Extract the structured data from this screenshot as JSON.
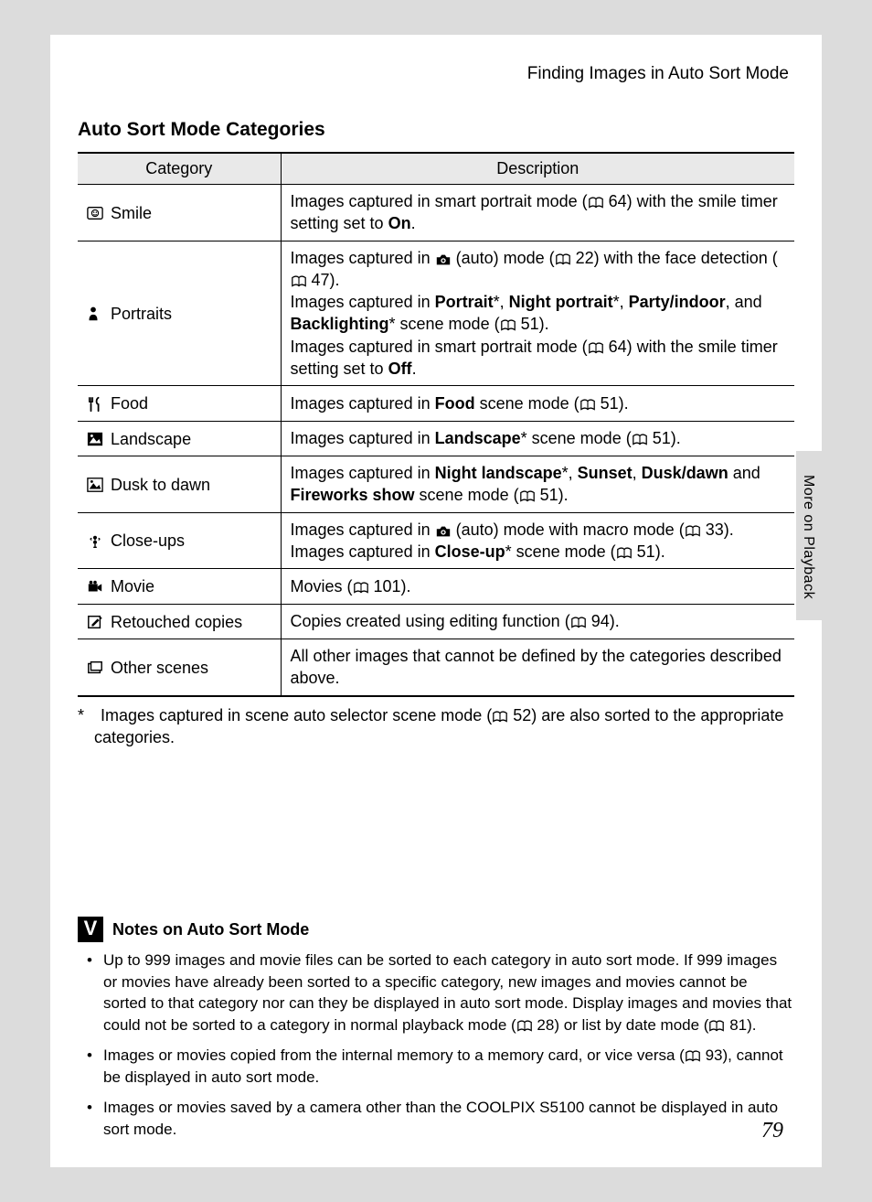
{
  "header": {
    "running": "Finding Images in Auto Sort Mode"
  },
  "section": {
    "title": "Auto Sort Mode Categories"
  },
  "table": {
    "head": {
      "c1": "Category",
      "c2": "Description"
    },
    "rows": [
      {
        "icon": "smile",
        "label": "Smile",
        "desc": "Images captured in smart portrait mode (📖 64) with the smile timer setting set to <b>On</b>."
      },
      {
        "icon": "portrait",
        "label": "Portraits",
        "desc": "Images captured in 📷 (auto) mode (📖 22) with the face detection (📖 47).<br>Images captured in <b>Portrait</b>*, <b>Night portrait</b>*, <b>Party/indoor</b>, and <b>Backlighting</b>* scene mode (📖 51).<br>Images captured in smart portrait mode (📖 64) with the smile timer setting set to <b>Off</b>."
      },
      {
        "icon": "food",
        "label": "Food",
        "desc": "Images captured in <b>Food</b> scene mode (📖 51)."
      },
      {
        "icon": "landscape",
        "label": "Landscape",
        "desc": "Images captured in <b>Landscape</b>* scene mode (📖 51)."
      },
      {
        "icon": "dusk",
        "label": "Dusk to dawn",
        "desc": "Images captured in <b>Night landscape</b>*, <b>Sunset</b>, <b>Dusk/dawn</b> and <b>Fireworks show</b> scene mode (📖 51)."
      },
      {
        "icon": "closeup",
        "label": "Close-ups",
        "desc": "Images captured in 📷 (auto) mode with macro mode (📖 33).<br>Images captured in <b>Close-up</b>* scene mode (📖 51)."
      },
      {
        "icon": "movie",
        "label": "Movie",
        "desc": "Movies (📖 101)."
      },
      {
        "icon": "retouch",
        "label": "Retouched copies",
        "desc": "Copies created using editing function (📖 94)."
      },
      {
        "icon": "other",
        "label": "Other scenes",
        "desc": "All other images that cannot be defined by the categories described above."
      }
    ]
  },
  "footnote": "* Images captured in scene auto selector scene mode (📖 52) are also sorted to the appropriate categories.",
  "sidetab": "More on Playback",
  "notes": {
    "title": "Notes on Auto Sort Mode",
    "items": [
      "Up to 999 images and movie files can be sorted to each category in auto sort mode. If 999 images or movies have already been sorted to a specific category, new images and movies cannot be sorted to that category nor can they be displayed in auto sort mode. Display images and movies that could not be sorted to a category in normal playback mode (📖 28) or list by date mode (📖 81).",
      "Images or movies copied from the internal memory to a memory card, or vice versa (📖 93), cannot be displayed in auto sort mode.",
      "Images or movies saved by a camera other than the COOLPIX S5100 cannot be displayed in auto sort mode."
    ]
  },
  "pagenum": "79"
}
